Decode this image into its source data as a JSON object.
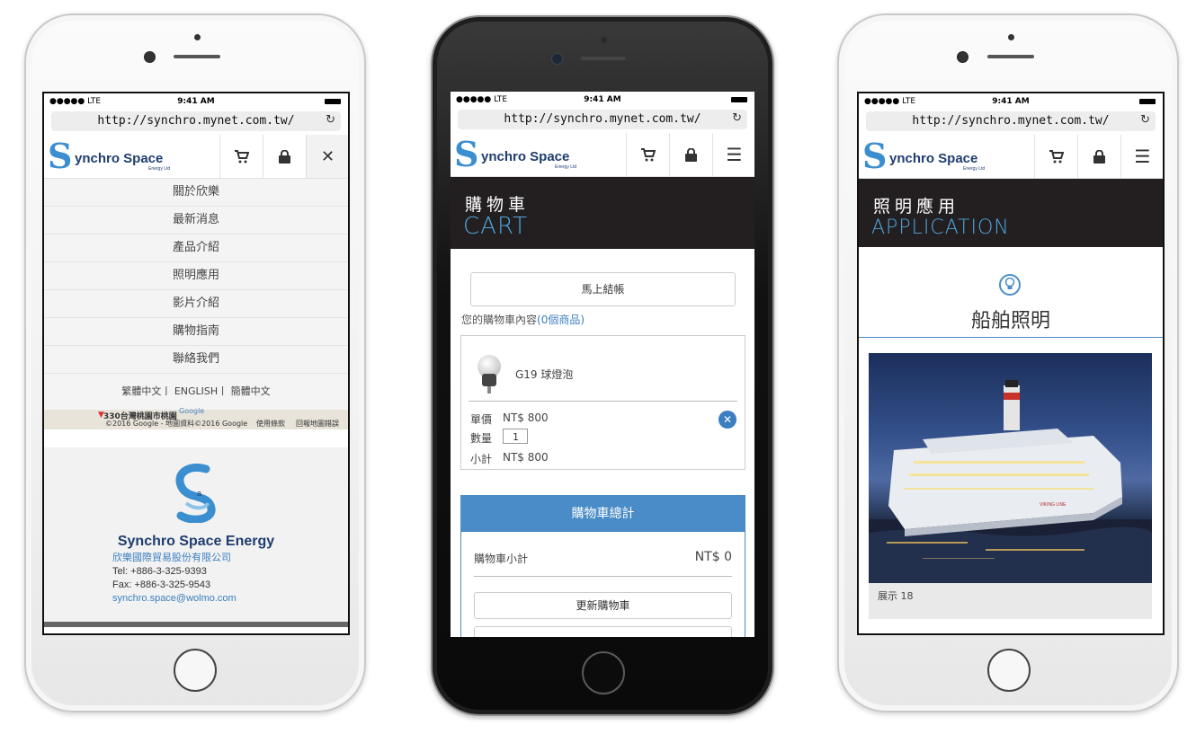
{
  "status_bar": {
    "signal": "●●●●● LTE",
    "time": "9:41 AM"
  },
  "browser": {
    "url": "http://synchro.mynet.com.tw/"
  },
  "logo": {
    "name": "ynchro Space",
    "sub": "Energy Ltd"
  },
  "menu_screen": {
    "nav_items": [
      "關於欣樂",
      "最新消息",
      "產品介紹",
      "照明應用",
      "影片介紹",
      "購物指南",
      "聯絡我們"
    ],
    "languages": "繁體中文丨 ENGLISH丨 簡體中文",
    "map": {
      "place": "330台灣桃園市桃園",
      "credit": "©2016 Google - 地圖資料©2016 Google",
      "terms": "使用條款",
      "report": "回報地圖錯誤",
      "brand": "Google"
    },
    "footer": {
      "company_en": "Synchro Space Energy",
      "company_zh": "欣樂國際貿易股份有限公司",
      "tel": "Tel: +886-3-325-9393",
      "fax": "Fax: +886-3-325-9543",
      "email": "synchro.space@wolmo.com"
    }
  },
  "cart_screen": {
    "banner_zh": "購物車",
    "banner_en": "CART",
    "checkout_button": "馬上結帳",
    "cart_contents_label": "您的購物車內容",
    "cart_count": "(0個商品)",
    "item": {
      "name": "G19 球燈泡",
      "price_label": "單價",
      "price": "NT$ 800",
      "qty_label": "數量",
      "qty": "1",
      "subtotal_label": "小計",
      "subtotal": "NT$ 800"
    },
    "totals_header": "購物車總計",
    "cart_subtotal_label": "購物車小計",
    "cart_subtotal": "NT$ 0",
    "update_button": "更新購物車"
  },
  "application_screen": {
    "banner_zh": "照明應用",
    "banner_en": "APPLICATION",
    "section_title": "船舶照明",
    "caption": "展示 18"
  }
}
